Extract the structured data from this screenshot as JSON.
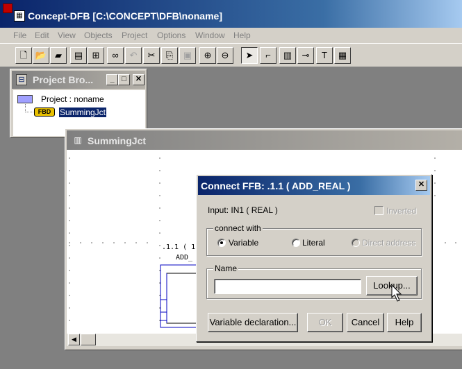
{
  "app": {
    "title": "Concept-DFB [C:\\CONCEPT\\DFB\\noname]",
    "menu": [
      "File",
      "Edit",
      "View",
      "Objects",
      "Project",
      "Options",
      "Window",
      "Help"
    ]
  },
  "toolbar": {
    "icons": [
      "new-icon",
      "open-icon",
      "save-icon",
      "properties-icon",
      "hierarchy-icon",
      "find-icon",
      "undo-icon",
      "cut-icon",
      "copy-icon",
      "paste-icon",
      "zoom-in-icon",
      "zoom-out-icon",
      "select-icon",
      "link-icon",
      "ffb-icon",
      "connection-icon",
      "text-icon",
      "grid-icon"
    ]
  },
  "project_browser": {
    "title": "Project Bro...",
    "project_label": "Project : noname",
    "fbd_badge": "FBD",
    "item": "SummingJct"
  },
  "editor": {
    "title": "SummingJct",
    "block_instance": ".1.1 ( 1 )",
    "block_type": "ADD_"
  },
  "dialog": {
    "title": "Connect FFB:  .1.1  ( ADD_REAL )",
    "input_label": "Input:  IN1  ( REAL )",
    "inverted_label": "Inverted",
    "connect_with_label": "connect with",
    "radio_variable": "Variable",
    "radio_literal": "Literal",
    "radio_direct": "Direct address",
    "name_group_label": "Name",
    "name_value": "",
    "lookup_button": "Lookup...",
    "var_decl_button": "Variable declaration...",
    "ok_button": "OK",
    "cancel_button": "Cancel",
    "help_button": "Help",
    "selected_radio": "Variable"
  }
}
